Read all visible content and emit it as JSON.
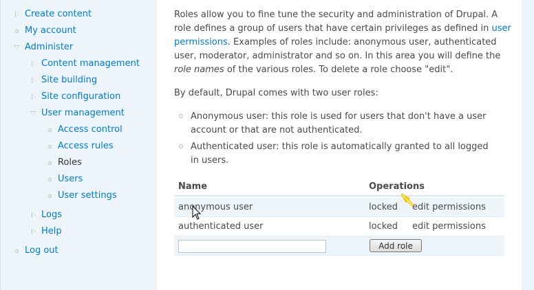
{
  "sidebar": {
    "items": [
      {
        "label": "Create content",
        "icon": "triangle-right-icon",
        "active": false
      },
      {
        "label": "My account",
        "icon": "bullet-icon",
        "active": false
      },
      {
        "label": "Administer",
        "icon": "triangle-down-icon",
        "active": false
      },
      {
        "label": "Content management",
        "icon": "triangle-right-icon",
        "active": false
      },
      {
        "label": "Site building",
        "icon": "triangle-right-icon",
        "active": false
      },
      {
        "label": "Site configuration",
        "icon": "triangle-right-icon",
        "active": false
      },
      {
        "label": "User management",
        "icon": "triangle-down-icon",
        "active": false
      },
      {
        "label": "Access control",
        "icon": "bullet-icon",
        "active": false
      },
      {
        "label": "Access rules",
        "icon": "bullet-icon",
        "active": false
      },
      {
        "label": "Roles",
        "icon": "bullet-icon",
        "active": true
      },
      {
        "label": "Users",
        "icon": "bullet-icon",
        "active": false
      },
      {
        "label": "User settings",
        "icon": "bullet-icon",
        "active": false
      },
      {
        "label": "Logs",
        "icon": "triangle-right-icon",
        "active": false
      },
      {
        "label": "Help",
        "icon": "triangle-right-icon",
        "active": false
      },
      {
        "label": "Log out",
        "icon": "bullet-icon",
        "active": false
      }
    ]
  },
  "intro": {
    "part1": "Roles allow you to fine tune the security and administration of Drupal. A role defines a group of users that have certain privileges as defined in ",
    "link": "user permissions",
    "part2": ". Examples of roles include: anonymous user, authenticated user, moderator, administrator and so on. In this area you will define the ",
    "em": "role names",
    "part3": " of the various roles. To delete a role choose \"edit\"."
  },
  "default_note": "By default, Drupal comes with two user roles:",
  "default_roles": [
    "Anonymous user: this role is used for users that don't have a user account or that are not authenticated.",
    "Authenticated user: this role is automatically granted to all logged in users."
  ],
  "table": {
    "headers": {
      "name": "Name",
      "operations": "Operations"
    },
    "rows": [
      {
        "name": "anonymous user",
        "status": "locked",
        "action": "edit permissions"
      },
      {
        "name": "authenticated user",
        "status": "locked",
        "action": "edit permissions"
      }
    ],
    "new_role_value": "",
    "add_button": "Add role"
  },
  "colors": {
    "link": "#027ac6",
    "sidebar_bg": "#edf5fa",
    "text": "#494949"
  }
}
